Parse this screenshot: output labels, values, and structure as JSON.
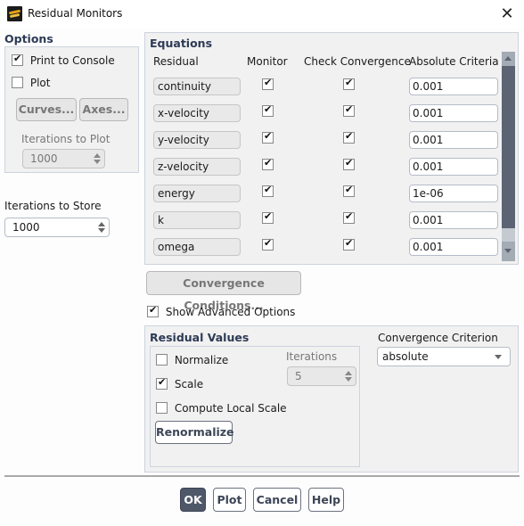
{
  "window": {
    "title": "Residual Monitors",
    "close_icon": "close-icon",
    "app_icon": "fluent-app-icon"
  },
  "options": {
    "heading": "Options",
    "print_to_console": {
      "label": "Print to Console",
      "checked": true
    },
    "plot": {
      "label": "Plot",
      "checked": false
    },
    "curves_button": "Curves...",
    "axes_button": "Axes...",
    "iterations_to_plot": {
      "label": "Iterations to Plot",
      "value": "1000"
    }
  },
  "iterations_to_store": {
    "label": "Iterations to Store",
    "value": "1000"
  },
  "equations": {
    "heading": "Equations",
    "columns": [
      "Residual",
      "Monitor",
      "Check Convergence",
      "Absolute Criteria"
    ],
    "rows": [
      {
        "residual": "continuity",
        "monitor": true,
        "check": true,
        "criteria": "0.001"
      },
      {
        "residual": "x-velocity",
        "monitor": true,
        "check": true,
        "criteria": "0.001"
      },
      {
        "residual": "y-velocity",
        "monitor": true,
        "check": true,
        "criteria": "0.001"
      },
      {
        "residual": "z-velocity",
        "monitor": true,
        "check": true,
        "criteria": "0.001"
      },
      {
        "residual": "energy",
        "monitor": true,
        "check": true,
        "criteria": "1e-06"
      },
      {
        "residual": "k",
        "monitor": true,
        "check": true,
        "criteria": "0.001"
      },
      {
        "residual": "omega",
        "monitor": true,
        "check": true,
        "criteria": "0.001"
      }
    ]
  },
  "convergence_conditions_button": "Convergence Conditions...",
  "show_advanced_options": {
    "label": "Show Advanced Options",
    "checked": true
  },
  "residual_values": {
    "heading": "Residual Values",
    "normalize": {
      "label": "Normalize",
      "checked": false
    },
    "scale": {
      "label": "Scale",
      "checked": true
    },
    "compute_local_scale": {
      "label": "Compute Local Scale",
      "checked": false
    },
    "iterations": {
      "label": "Iterations",
      "value": "5"
    },
    "renormalize_button": "Renormalize"
  },
  "convergence_criterion": {
    "label": "Convergence Criterion",
    "selected": "absolute"
  },
  "footer": {
    "ok": "OK",
    "plot": "Plot",
    "cancel": "Cancel",
    "help": "Help"
  }
}
